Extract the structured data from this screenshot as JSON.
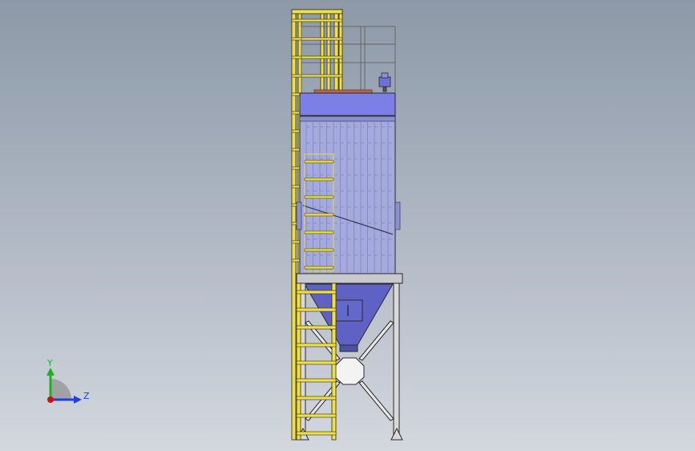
{
  "view": {
    "axes": {
      "x_label": "",
      "y_label": "Y",
      "z_label": "Z"
    },
    "colors": {
      "background_top": "#8d99a8",
      "background_bottom": "#d3d8df",
      "body_fill": "#9ea7d8",
      "header_fill": "#7b7fe6",
      "hopper_fill": "#5f62c4",
      "frame_yellow": "#f2e040",
      "frame_stroke": "#2a2a2a",
      "rail_gray": "#c9c9c9",
      "y_axis": "#1fb21f",
      "z_axis": "#2040e0",
      "x_axis": "#d01010"
    },
    "model": {
      "name_icon": "dust-collector-model",
      "parts": [
        "ladder-cage",
        "top-guardrail",
        "roof-header",
        "filter-housing",
        "access-ladder",
        "hopper",
        "discharge-valve",
        "support-legs",
        "cross-bracing"
      ]
    }
  }
}
